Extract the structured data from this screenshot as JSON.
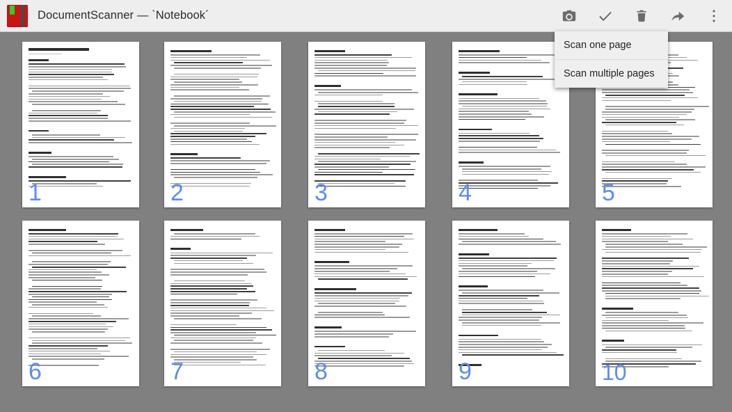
{
  "window": {
    "title": "DocumentScanner — `Notebook´",
    "app_icon": "notebook-icon",
    "titlebar_color": "#eeeeee",
    "canvas_color": "#808080"
  },
  "toolbar": {
    "buttons": [
      {
        "name": "camera-icon",
        "label": "Scan"
      },
      {
        "name": "check-icon",
        "label": "Done"
      },
      {
        "name": "trash-icon",
        "label": "Delete"
      },
      {
        "name": "share-icon",
        "label": "Share"
      },
      {
        "name": "overflow-menu-icon",
        "label": "More options"
      }
    ]
  },
  "dropdown": {
    "open": true,
    "background": "#efefef",
    "items": [
      {
        "label": "Scan one page"
      },
      {
        "label": "Scan multiple pages"
      }
    ]
  },
  "grid": {
    "columns": 5,
    "rows": 2,
    "page_number_color": "#5b8dee",
    "pages": [
      {
        "number": "1",
        "title": "DocumentScanner Help",
        "sections": [
          "Getting started",
          "Notebooks board",
          "Action bars",
          "Notebook and folder icons"
        ]
      },
      {
        "number": "2",
        "title": "Usage",
        "sections": [
          "Usage",
          "A scanner"
        ]
      },
      {
        "number": "3",
        "title": "Notebook view",
        "sections": [
          "Action bars",
          "Usage"
        ]
      },
      {
        "number": "4",
        "title": "Page view",
        "sections": [
          "Notebook Creation",
          "Scan Page",
          "Action bars",
          "Usage",
          "Others"
        ]
      },
      {
        "number": "5",
        "title": "Image editing",
        "sections": [
          "Import and export"
        ]
      },
      {
        "number": "6",
        "title": "Export options",
        "sections": [
          "Storage"
        ]
      },
      {
        "number": "7",
        "title": "Sharing",
        "sections": [
          "Storage",
          "Handling"
        ]
      },
      {
        "number": "8",
        "title": "Appendix: Settings",
        "sections": [
          "Display",
          "General",
          "Orientation and appearance",
          "Sort",
          "Menu",
          "Handling"
        ]
      },
      {
        "number": "9",
        "title": "Settings continued",
        "sections": [
          "Import",
          "Export",
          "PDF",
          "Evernote and Dropbox",
          "Storage",
          "Directories",
          "Time stamps"
        ]
      },
      {
        "number": "10",
        "title": "Settings reference",
        "sections": [
          "Import",
          "Export",
          "PDF",
          "Evernote and Dropbox",
          "Storage",
          "Directories",
          "Time stamps"
        ]
      }
    ]
  }
}
